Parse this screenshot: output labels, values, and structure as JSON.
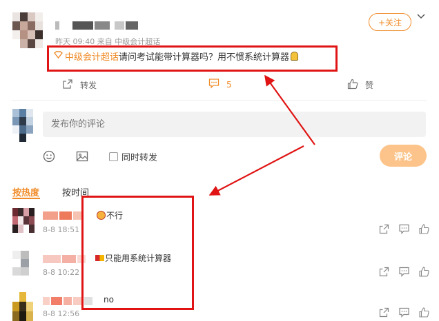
{
  "post": {
    "meta": "昨天 09:40 来自 中级会计超话",
    "follow_label": "+关注",
    "topic_tag": "中级会计超话",
    "question": "请问考试能带计算器吗？用不惯系统计算器",
    "repost_label": "转发",
    "comment_count": "5",
    "like_label": "赞"
  },
  "composer": {
    "placeholder": "发布你的评论",
    "also_repost_label": "同时转发",
    "submit_label": "评论"
  },
  "sort_tabs": {
    "hot": "按热度",
    "time": "按时间"
  },
  "comments": [
    {
      "text": "不行",
      "time": "8-8 18:51"
    },
    {
      "text": "只能用系统计算器",
      "time": "8-8 10:22"
    },
    {
      "text": "no",
      "time": "8-8 12:56"
    }
  ],
  "colors": {
    "accent": "#f08c2a",
    "submit_bg": "#fcc48a",
    "annotation_red": "#e01414"
  }
}
